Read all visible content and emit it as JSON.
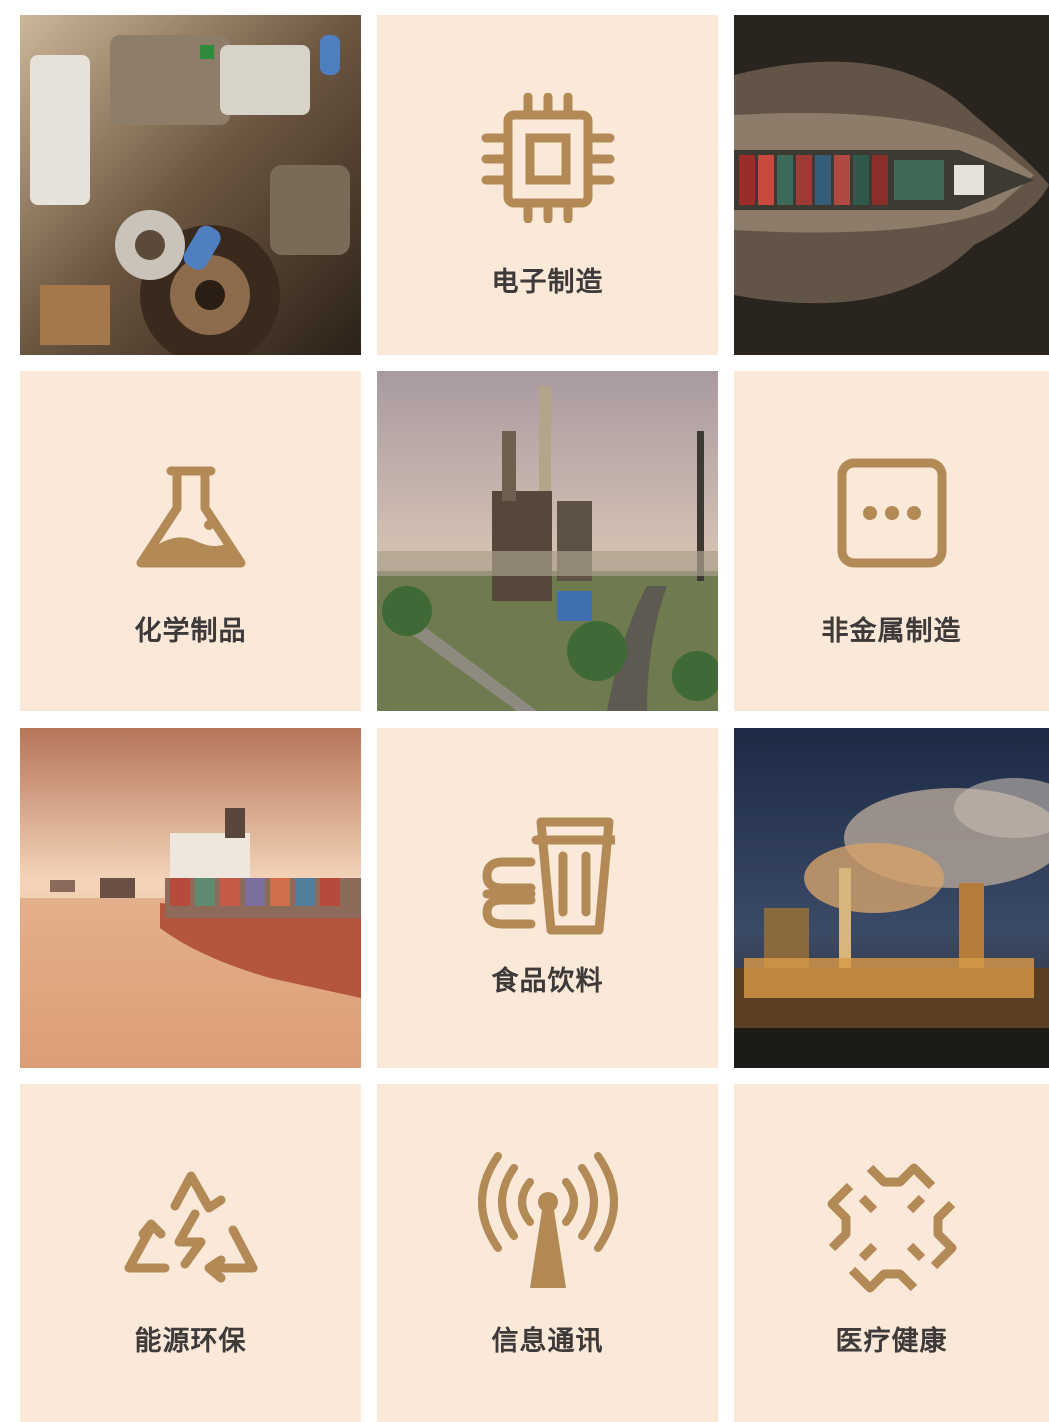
{
  "colors": {
    "accent": "#b38a55",
    "card_bg": "#fae8d9",
    "label": "#3e3a39"
  },
  "tiles": [
    {
      "kind": "photo",
      "subject": "engine-machinery"
    },
    {
      "kind": "card",
      "icon": "chip-icon",
      "label": "电子制造"
    },
    {
      "kind": "photo",
      "subject": "container-ship-aerial"
    },
    {
      "kind": "card",
      "icon": "flask-icon",
      "label": "化学制品"
    },
    {
      "kind": "photo",
      "subject": "refinery-plant"
    },
    {
      "kind": "card",
      "icon": "more-box-icon",
      "label": "非金属制造"
    },
    {
      "kind": "photo",
      "subject": "cargo-ship-sunset"
    },
    {
      "kind": "card",
      "icon": "food-drink-icon",
      "label": "食品饮料"
    },
    {
      "kind": "photo",
      "subject": "power-plant-night"
    },
    {
      "kind": "card",
      "icon": "recycle-energy-icon",
      "label": "能源环保"
    },
    {
      "kind": "card",
      "icon": "antenna-signal-icon",
      "label": "信息通讯"
    },
    {
      "kind": "card",
      "icon": "medical-cross-icon",
      "label": "医疗健康"
    }
  ]
}
